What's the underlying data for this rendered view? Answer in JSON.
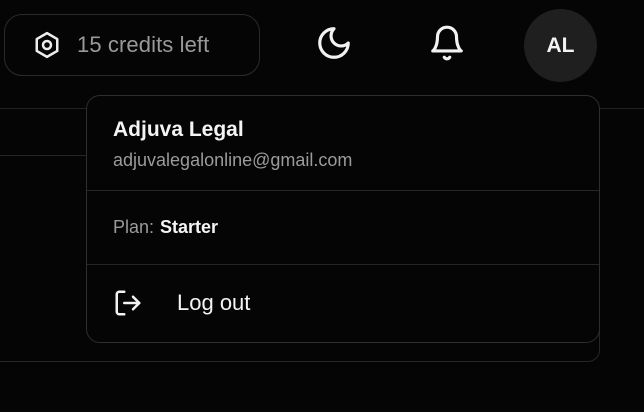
{
  "header": {
    "credits": {
      "icon": "hexagon-settings-icon",
      "label": "15 credits left"
    },
    "theme_toggle": {
      "icon": "moon-icon"
    },
    "notifications": {
      "icon": "bell-icon"
    },
    "avatar": {
      "initials": "AL"
    }
  },
  "user_menu": {
    "name": "Adjuva Legal",
    "email": "adjuvalegalonline@gmail.com",
    "plan_label": "Plan:",
    "plan_value": "Starter",
    "logout": {
      "icon": "log-out-icon",
      "label": "Log out"
    }
  },
  "colors": {
    "background": "#050505",
    "border": "#2e2e2e",
    "text_primary": "#f4f4f4",
    "text_muted": "#9b9b9b",
    "avatar_bg": "#1f1f1f"
  }
}
